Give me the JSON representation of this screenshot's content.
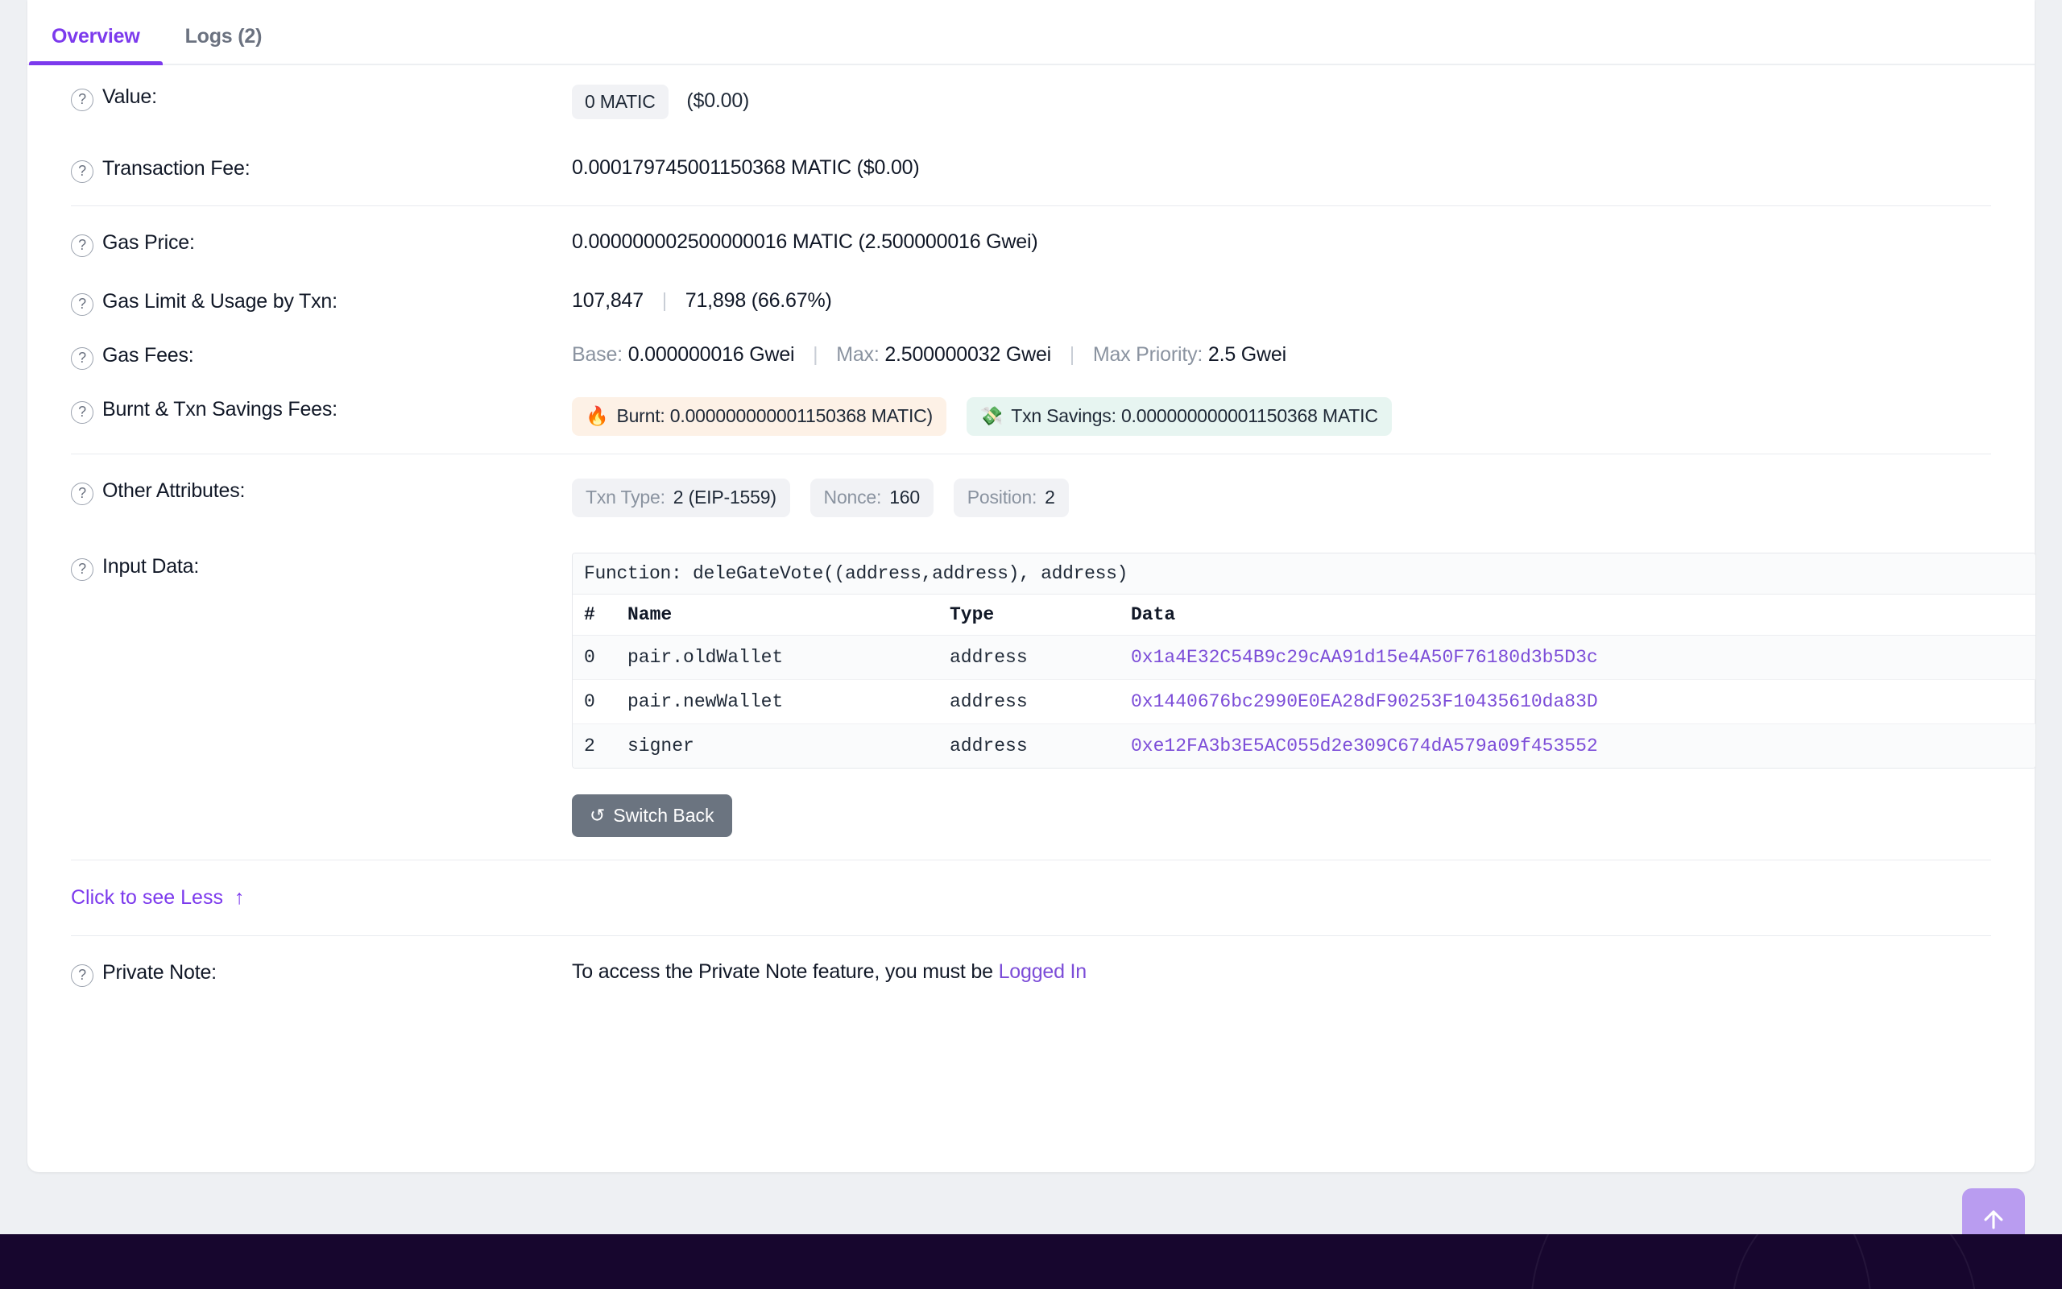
{
  "tabs": [
    {
      "label": "Overview",
      "active": true
    },
    {
      "label": "Logs (2)",
      "active": false
    }
  ],
  "rows": {
    "value": {
      "label": "Value:",
      "pill": "0 MATIC",
      "usd": "($0.00)"
    },
    "transaction_fee": {
      "label": "Transaction Fee:",
      "value": "0.000179745001150368 MATIC ($0.00)"
    },
    "gas_price": {
      "label": "Gas Price:",
      "value": "0.000000002500000016 MATIC (2.500000016 Gwei)"
    },
    "gas_limit": {
      "label": "Gas Limit & Usage by Txn:",
      "limit": "107,847",
      "divider": "|",
      "usage": "71,898 (66.67%)"
    },
    "gas_fees": {
      "label": "Gas Fees:",
      "base_label": "Base:",
      "base_value": "0.000000016 Gwei",
      "div1": "|",
      "max_label": "Max:",
      "max_value": "2.500000032 Gwei",
      "div2": "|",
      "priority_label": "Max Priority:",
      "priority_value": "2.5 Gwei"
    },
    "burnt_savings": {
      "label": "Burnt & Txn Savings Fees:",
      "burnt_icon": "fire-icon",
      "burnt_text": "Burnt: 0.000000000001150368 MATIC)",
      "savings_icon": "money-wings-icon",
      "savings_text": "Txn Savings: 0.000000000001150368 MATIC"
    },
    "other_attributes": {
      "label": "Other Attributes:",
      "badges": [
        {
          "key": "Txn Type:",
          "value": "2 (EIP-1559)"
        },
        {
          "key": "Nonce:",
          "value": "160"
        },
        {
          "key": "Position:",
          "value": "2"
        }
      ]
    },
    "input_data": {
      "label": "Input Data:",
      "function_signature": "Function: deleGateVote((address,address), address)",
      "headers": [
        "#",
        "Name",
        "Type",
        "Data"
      ],
      "rows": [
        {
          "index": "0",
          "name": "pair.oldWallet",
          "type": "address",
          "data": "0x1a4E32C54B9c29cAA91d15e4A50F76180d3b5D3c"
        },
        {
          "index": "0",
          "name": "pair.newWallet",
          "type": "address",
          "data": "0x1440676bc2990E0EA28dF90253F10435610da83D"
        },
        {
          "index": "2",
          "name": "signer",
          "type": "address",
          "data": "0xe12FA3b3E5AC055d2e309C674dA579a09f453552"
        }
      ],
      "switch_back_label": "Switch Back",
      "switch_back_icon": "undo-icon"
    },
    "see_less": {
      "label": "Click to see Less",
      "icon": "arrow-up-icon"
    },
    "private_note": {
      "label": "Private Note:",
      "text": "To access the Private Note feature, you must be",
      "link": "Logged In"
    }
  },
  "scroll_top_button": {
    "icon": "arrow-up-icon"
  },
  "colors": {
    "accent": "#7c3aed",
    "link": "#7c4dd8",
    "burnt_bg": "#fdf1e6",
    "savings_bg": "#e7f5f1",
    "pill_bg": "#f1f2f5",
    "button_gray": "#6b7480",
    "scroll_button": "#b99cf0",
    "footer": "#17062e"
  }
}
